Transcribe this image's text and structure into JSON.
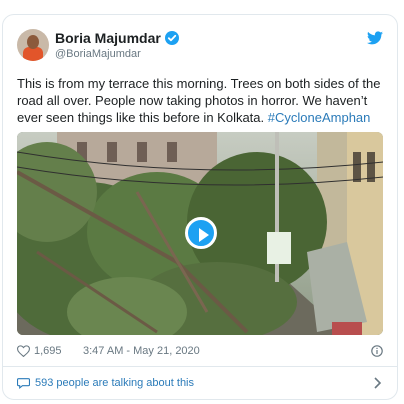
{
  "tweet": {
    "author_name": "Boria Majumdar",
    "handle": "@BoriaMajumdar",
    "text_main": "This is from my terrace this morning. Trees on both sides of the road all over. People now taking photos in horror. We haven’t ever seen things like this before in Kolkata. ",
    "hashtag": "#CycloneAmphan",
    "likes": "1,695",
    "timestamp": "3:47 AM - May 21, 2020",
    "talking": "593 people are talking about this"
  },
  "colors": {
    "accent": "#1da1f2",
    "link": "#2b7bb9",
    "muted": "#697882"
  },
  "icons": [
    "verified-badge-icon",
    "twitter-bird-icon",
    "play-icon",
    "heart-icon",
    "info-icon",
    "speech-bubble-icon",
    "chevron-right-icon"
  ]
}
